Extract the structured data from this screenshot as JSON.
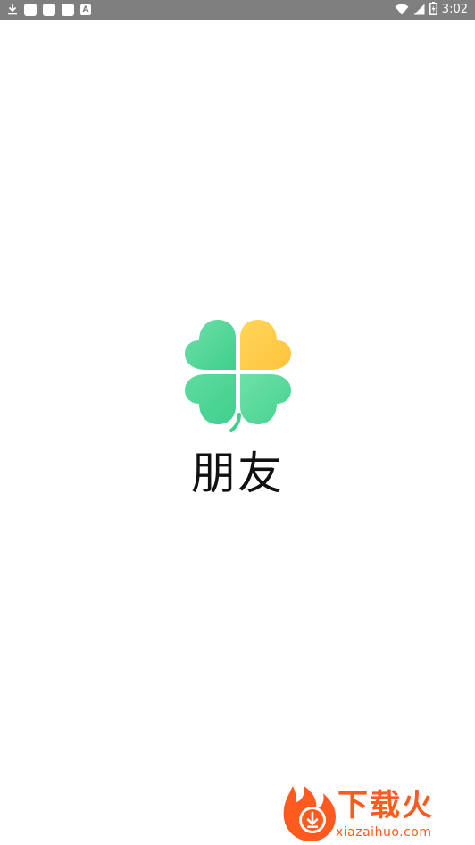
{
  "status_bar": {
    "time": "3:02",
    "notification_icons": [
      "download-icon",
      "notification-square-icon",
      "notification-square-icon",
      "notification-square-icon",
      "a-badge-icon"
    ],
    "notification_a_label": "A",
    "right_icons": [
      "wifi-icon",
      "signal-icon",
      "battery-icon"
    ]
  },
  "splash": {
    "app_name": "朋友",
    "logo_icon": "four-leaf-clover-icon",
    "colors": {
      "leaf_green_light": "#6ee0a8",
      "leaf_green": "#3fcf8e",
      "leaf_yellow": "#ffd65a",
      "leaf_orange_yellow": "#ffc23c"
    }
  },
  "watermark": {
    "logo_icon": "flame-download-icon",
    "text": "下载火",
    "url": "xiazaihuo.com",
    "color": "#ff5a1f"
  }
}
